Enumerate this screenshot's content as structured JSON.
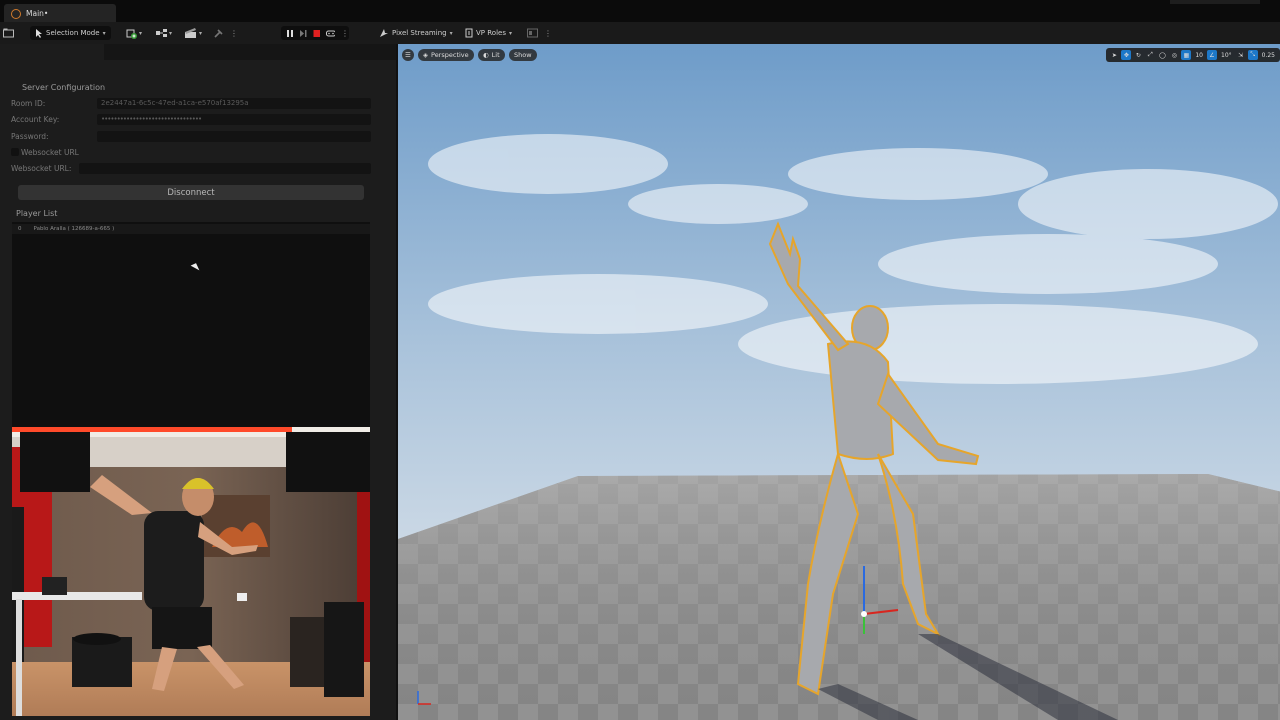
{
  "tab": {
    "title": "Main•"
  },
  "toolbar": {
    "selection_mode": "Selection Mode",
    "pixel_streaming": "Pixel Streaming",
    "vp_roles": "VP Roles"
  },
  "server_config": {
    "title": "Server Configuration",
    "room_id_label": "Room ID:",
    "room_id_value": "2e2447a1-6c5c-47ed-a1ca-e570af13295a",
    "account_key_label": "Account Key:",
    "account_key_value": "••••••••••••••••••••••••••••••••",
    "password_label": "Password:",
    "password_value": "",
    "websocket_checkbox_label": "Websocket URL",
    "websocket_url_label": "Websocket URL:",
    "websocket_url_value": "",
    "disconnect_label": "Disconnect"
  },
  "player_list": {
    "title": "Player List",
    "players": [
      {
        "index": "0",
        "name": "Pablo Aralla ( 126689-a-665 )"
      }
    ]
  },
  "viewport": {
    "perspective": "Perspective",
    "lit": "Lit",
    "show": "Show",
    "grid_snap": "10",
    "rotation_snap": "10°",
    "camera_speed": "0.25"
  },
  "colors": {
    "accent": "#1d78c8",
    "stop_red": "#e02020",
    "selection_outline": "#e6a52b"
  }
}
